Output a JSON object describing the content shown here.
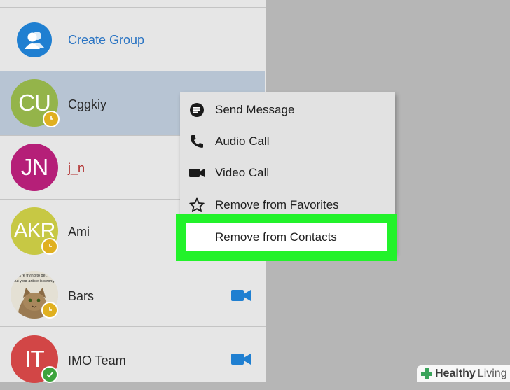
{
  "colors": {
    "sidebar_bg": "#e6e6e6",
    "main_bg": "#b6b6b6",
    "selected_row": "#b7c4d3",
    "accent_blue": "#1f7fd1",
    "highlight_green": "#22f22a"
  },
  "header": {
    "create_group_label": "Create Group",
    "create_group_icon": "group-add-icon"
  },
  "contacts": [
    {
      "initials": "CU",
      "name": "Cggkiy",
      "avatar_color": "#94b44a",
      "status": "clock",
      "selected": true
    },
    {
      "initials": "JN",
      "name": "j_n",
      "avatar_color": "#b51f78",
      "status": "none",
      "selected": false
    },
    {
      "initials": "AKR",
      "name": "Ami",
      "avatar_color": "#c7c844",
      "status": "clock",
      "selected": false
    },
    {
      "initials": "",
      "name": "Bars",
      "avatar_caption_1": "you're trying to be...",
      "avatar_caption_2": "out your article is stronger",
      "status": "clock",
      "video": true,
      "selected": false
    },
    {
      "initials": "IT",
      "name": "IMO Team",
      "avatar_color": "#d24646",
      "status": "check",
      "video": true,
      "selected": false
    }
  ],
  "context_menu": {
    "items": [
      {
        "label": "Send Message",
        "icon": "message-icon"
      },
      {
        "label": "Audio Call",
        "icon": "phone-icon"
      },
      {
        "label": "Video Call",
        "icon": "video-camera-icon"
      },
      {
        "label": "Remove from Favorites",
        "icon": "star-outline-icon"
      },
      {
        "label": "Remove from Contacts",
        "icon": "none",
        "highlighted": true
      }
    ]
  },
  "watermark": {
    "text_bold": "Healthy",
    "text_light": "Living"
  }
}
